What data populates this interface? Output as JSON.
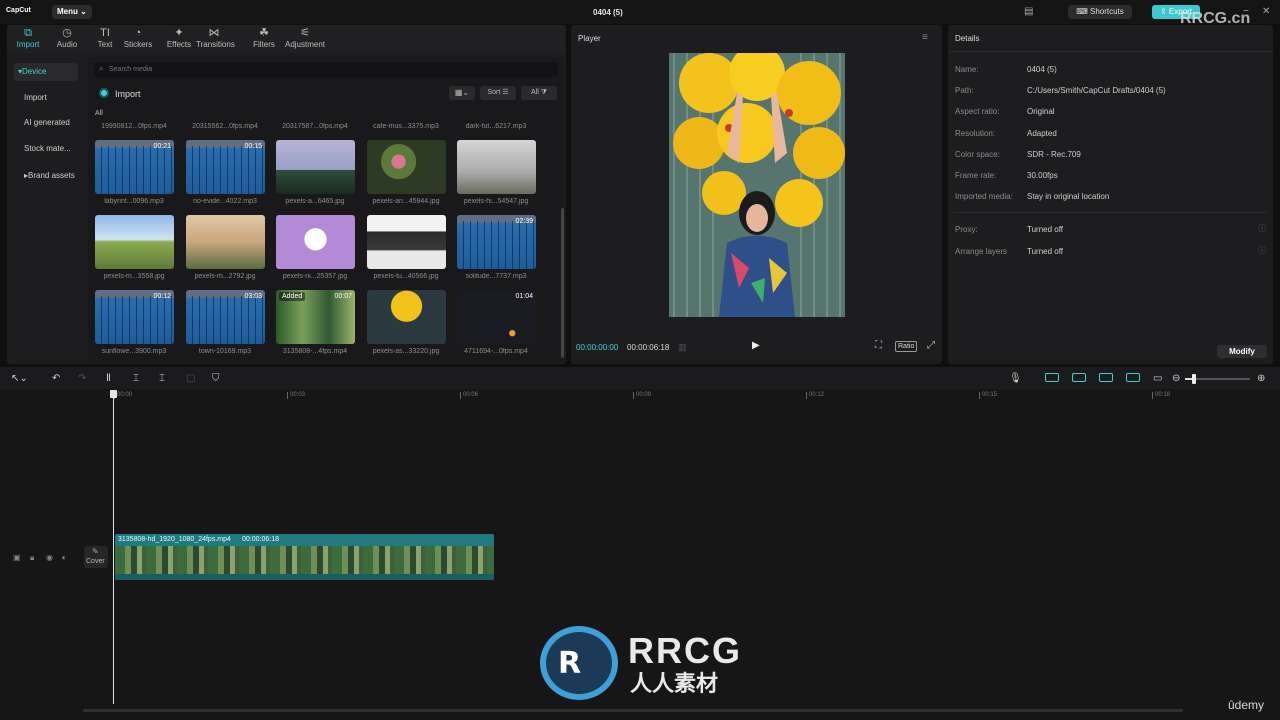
{
  "app": {
    "logo_text": "CapCut",
    "menu_label": "Menu",
    "project_title": "0404 (5)",
    "shortcuts_label": "Shortcuts",
    "export_label": "Export"
  },
  "toolbar": {
    "tabs": [
      {
        "label": "Import",
        "icon": "import-icon"
      },
      {
        "label": "Audio",
        "icon": "audio-icon"
      },
      {
        "label": "Text",
        "icon": "text-icon"
      },
      {
        "label": "Stickers",
        "icon": "sticker-icon"
      },
      {
        "label": "Effects",
        "icon": "effects-icon"
      },
      {
        "label": "Transitions",
        "icon": "transitions-icon"
      },
      {
        "label": "Filters",
        "icon": "filters-icon"
      },
      {
        "label": "Adjustment",
        "icon": "adjustment-icon"
      }
    ]
  },
  "sidebar": {
    "items": [
      "Device",
      "Import",
      "AI generated",
      "Stock mate...",
      "Brand assets"
    ]
  },
  "media": {
    "search_placeholder": "Search media",
    "import_label": "Import",
    "sort_label": "Sort",
    "filter_label": "All",
    "section_label": "All",
    "top_row_names": [
      "19990812...0fps.mp4",
      "20315562...0fps.mp4",
      "20317587...0fps.mp4",
      "cafe-mus...3375.mp3",
      "dark-fut...6217.mp3"
    ],
    "rows": [
      [
        {
          "name": "labyrint...0096.mp3",
          "duration": "00:21",
          "kind": "audio"
        },
        {
          "name": "no-evide...4022.mp3",
          "duration": "00:15",
          "kind": "audio"
        },
        {
          "name": "pexels-a...6465.jpg",
          "duration": "",
          "kind": "image"
        },
        {
          "name": "pexels-an...45944.jpg",
          "duration": "",
          "kind": "image"
        },
        {
          "name": "pexels-hi...54547.jpg",
          "duration": "",
          "kind": "image"
        }
      ],
      [
        {
          "name": "pexels-m...3558.jpg",
          "duration": "",
          "kind": "image"
        },
        {
          "name": "pexels-m...2792.jpg",
          "duration": "",
          "kind": "image"
        },
        {
          "name": "pexels-ni...25357.jpg",
          "duration": "",
          "kind": "image"
        },
        {
          "name": "pexels-tu...40566.jpg",
          "duration": "",
          "kind": "image"
        },
        {
          "name": "solitude...7737.mp3",
          "duration": "02:39",
          "kind": "audio"
        }
      ],
      [
        {
          "name": "sunflowe...3900.mp3",
          "duration": "00:12",
          "kind": "audio"
        },
        {
          "name": "town-10169.mp3",
          "duration": "03:03",
          "kind": "audio"
        },
        {
          "name": "3135808-...4fps.mp4",
          "duration": "00:07",
          "kind": "video",
          "tag": "Added"
        },
        {
          "name": "pexels-as...33220.jpg",
          "duration": "",
          "kind": "image"
        },
        {
          "name": "4711694-...0fps.mp4",
          "duration": "01:04",
          "kind": "video"
        }
      ]
    ]
  },
  "player": {
    "title": "Player",
    "current_time": "00:00:00:00",
    "total_time": "00:00:06:18",
    "ratio_label": "Ratio"
  },
  "details": {
    "title": "Details",
    "rows": [
      {
        "label": "Name:",
        "value": "0404 (5)"
      },
      {
        "label": "Path:",
        "value": "C:/Users/Smith/CapCut Drafts/0404 (5)"
      },
      {
        "label": "Aspect ratio:",
        "value": "Original"
      },
      {
        "label": "Resolution:",
        "value": "Adapted"
      },
      {
        "label": "Color space:",
        "value": "SDR - Rec.709"
      },
      {
        "label": "Frame rate:",
        "value": "30.00fps"
      },
      {
        "label": "Imported media:",
        "value": "Stay in original location"
      }
    ],
    "rows2": [
      {
        "label": "Proxy:",
        "value": "Turned off"
      },
      {
        "label": "Arrange layers",
        "value": "Turned off"
      }
    ],
    "modify_label": "Modify"
  },
  "timeline": {
    "ticks": [
      "00:00",
      "00:03",
      "00:06",
      "00:09",
      "00:12",
      "00:15",
      "00:18"
    ],
    "clip_label": "3135808-hd_1920_1080_24fps.mp4",
    "clip_duration": "00:00:06:18",
    "cover_label": "Cover"
  },
  "watermark": {
    "brand": "RRCG",
    "sub": "人人素材",
    "site": "RRCG.cn",
    "udemy": "ûdemy"
  },
  "colors": {
    "accent": "#3fd0d6",
    "clip": "#1f7b80",
    "audio_thumb": "#2a6aa8"
  }
}
